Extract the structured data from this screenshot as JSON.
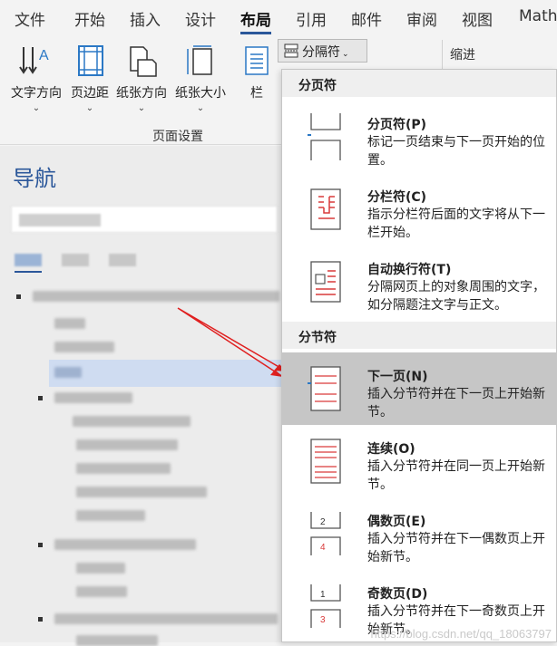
{
  "tabs": [
    "文件",
    "开始",
    "插入",
    "设计",
    "布局",
    "引用",
    "邮件",
    "审阅",
    "视图",
    "Math"
  ],
  "active_tab": "布局",
  "ribbon": {
    "buttons": [
      {
        "label": "文字方向",
        "icon": "text-direction-icon"
      },
      {
        "label": "页边距",
        "icon": "margins-icon"
      },
      {
        "label": "纸张方向",
        "icon": "orientation-icon"
      },
      {
        "label": "纸张大小",
        "icon": "size-icon"
      },
      {
        "label": "栏",
        "icon": "columns-icon"
      }
    ],
    "group_label": "页面设置",
    "breaks_button": "分隔符",
    "indent_label": "缩进"
  },
  "nav": {
    "title": "导航"
  },
  "menu": {
    "page_breaks_header": "分页符",
    "section_breaks_header": "分节符",
    "items": [
      {
        "title": "分页符(P)",
        "desc": "标记一页结束与下一页开始的位置。",
        "icon": "page-break-icon"
      },
      {
        "title": "分栏符(C)",
        "desc": "指示分栏符后面的文字将从下一栏开始。",
        "icon": "column-break-icon"
      },
      {
        "title": "自动换行符(T)",
        "desc": "分隔网页上的对象周围的文字，如分隔题注文字与正文。",
        "icon": "text-wrapping-break-icon"
      },
      {
        "title": "下一页(N)",
        "desc": "插入分节符并在下一页上开始新节。",
        "icon": "next-page-break-icon"
      },
      {
        "title": "连续(O)",
        "desc": "插入分节符并在同一页上开始新节。",
        "icon": "continuous-break-icon"
      },
      {
        "title": "偶数页(E)",
        "desc": "插入分节符并在下一偶数页上开始新节。",
        "icon": "even-page-break-icon"
      },
      {
        "title": "奇数页(D)",
        "desc": "插入分节符并在下一奇数页上开始新节。",
        "icon": "odd-page-break-icon"
      }
    ]
  },
  "watermark": "https://blog.csdn.net/qq_18063797"
}
